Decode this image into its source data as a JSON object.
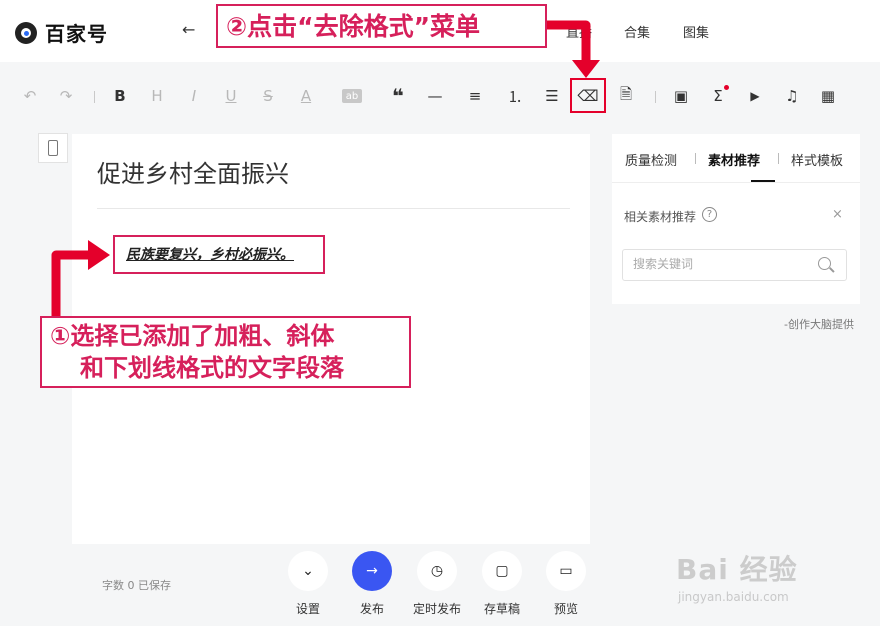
{
  "header": {
    "logo_text": "百家号",
    "back_icon": "arrow-left-icon",
    "nav": [
      "直播",
      "合集",
      "图集"
    ]
  },
  "toolbar": {
    "items": [
      {
        "name": "undo-icon",
        "glyph": "↶"
      },
      {
        "name": "redo-icon",
        "glyph": "↷"
      },
      {
        "name": "bold-icon",
        "glyph": "B"
      },
      {
        "name": "heading-icon",
        "glyph": "H"
      },
      {
        "name": "italic-icon",
        "glyph": "I"
      },
      {
        "name": "underline-icon",
        "glyph": "U"
      },
      {
        "name": "strikethrough-icon",
        "glyph": "S"
      },
      {
        "name": "font-color-icon",
        "glyph": "A"
      },
      {
        "name": "highlight-icon",
        "glyph": "ab"
      },
      {
        "name": "quote-icon",
        "glyph": "❝"
      },
      {
        "name": "divider-icon",
        "glyph": "—"
      },
      {
        "name": "align-icon",
        "glyph": "≡"
      },
      {
        "name": "ordered-list-icon",
        "glyph": "⒈"
      },
      {
        "name": "unordered-list-icon",
        "glyph": "☰"
      },
      {
        "name": "eraser-icon",
        "glyph": "⌫"
      },
      {
        "name": "template-icon",
        "glyph": "🗎"
      },
      {
        "name": "image-icon",
        "glyph": "▣"
      },
      {
        "name": "formula-icon",
        "glyph": "Σ"
      },
      {
        "name": "video-icon",
        "glyph": "▶"
      },
      {
        "name": "music-icon",
        "glyph": "♫"
      },
      {
        "name": "table-icon",
        "glyph": "▦"
      }
    ]
  },
  "editor": {
    "title": "促进乡村全面振兴",
    "paragraph": "民族要复兴，乡村必振兴。"
  },
  "side_panel": {
    "tabs": [
      "质量检测",
      "素材推荐",
      "样式模板"
    ],
    "active_tab": 1,
    "section_title": "相关素材推荐",
    "help_glyph": "?",
    "close_glyph": "×",
    "search_placeholder": "搜索关键词",
    "credit": "-创作大脑提供"
  },
  "footer": {
    "status": "字数 0  已保存",
    "actions": [
      {
        "label": "设置",
        "glyph": "⌄"
      },
      {
        "label": "发布",
        "glyph": "→"
      },
      {
        "label": "定时发布",
        "glyph": "◷"
      },
      {
        "label": "存草稿",
        "glyph": "▢"
      },
      {
        "label": "预览",
        "glyph": "▭"
      }
    ]
  },
  "annotations": {
    "step2": "②点击“去除格式”菜单",
    "step1_line1": "①选择已添加了加粗、斜体",
    "step1_line2": "和下划线格式的文字段落"
  },
  "watermark": {
    "text": "Bai 经验",
    "url": "jingyan.baidu.com"
  },
  "colors": {
    "annotation": "#d6205b",
    "primary": "#3a56f2"
  }
}
